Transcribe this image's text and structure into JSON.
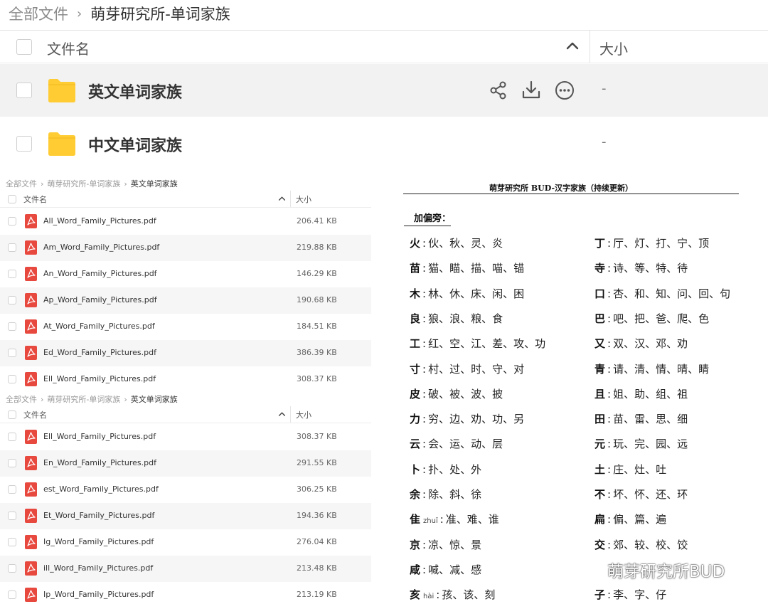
{
  "top_browser": {
    "breadcrumb_root": "全部文件",
    "breadcrumb_current": "萌芽研究所-单词家族",
    "header_name": "文件名",
    "header_size": "大小",
    "folders": [
      {
        "name": "英文单词家族",
        "size": "-"
      },
      {
        "name": "中文单词家族",
        "size": "-"
      }
    ]
  },
  "list_panel_1": {
    "breadcrumb": [
      "全部文件",
      "萌芽研究所-单词家族",
      "英文单词家族"
    ],
    "header_name": "文件名",
    "header_size": "大小",
    "files": [
      {
        "name": "All_Word_Family_Pictures.pdf",
        "size": "206.41 KB"
      },
      {
        "name": "Am_Word_Family_Pictures.pdf",
        "size": "219.88 KB"
      },
      {
        "name": "An_Word_Family_Pictures.pdf",
        "size": "146.29 KB"
      },
      {
        "name": "Ap_Word_Family_Pictures.pdf",
        "size": "190.68 KB"
      },
      {
        "name": "At_Word_Family_Pictures.pdf",
        "size": "184.51 KB"
      },
      {
        "name": "Ed_Word_Family_Pictures.pdf",
        "size": "386.39 KB"
      },
      {
        "name": "Ell_Word_Family_Pictures.pdf",
        "size": "308.37 KB"
      }
    ]
  },
  "list_panel_2": {
    "breadcrumb": [
      "全部文件",
      "萌芽研究所-单词家族",
      "英文单词家族"
    ],
    "header_name": "文件名",
    "header_size": "大小",
    "files": [
      {
        "name": "Ell_Word_Family_Pictures.pdf",
        "size": "308.37 KB"
      },
      {
        "name": "En_Word_Family_Pictures.pdf",
        "size": "291.55 KB"
      },
      {
        "name": "est_Word_Family_Pictures.pdf",
        "size": "306.25 KB"
      },
      {
        "name": "Et_Word_Family_Pictures.pdf",
        "size": "194.36 KB"
      },
      {
        "name": "Ig_Word_Family_Pictures.pdf",
        "size": "276.04 KB"
      },
      {
        "name": "ill_Word_Family_Pictures.pdf",
        "size": "213.48 KB"
      },
      {
        "name": "Ip_Word_Family_Pictures.pdf",
        "size": "213.19 KB"
      }
    ]
  },
  "document": {
    "title": "萌芽研究所 BUD-汉字家族（持续更新）",
    "section": "加偏旁：",
    "left_column": [
      {
        "radical": "火",
        "pinyin": "",
        "chars": "伙、秋、灵、炎"
      },
      {
        "radical": "苗",
        "pinyin": "",
        "chars": "猫、瞄、描、喵、锚"
      },
      {
        "radical": "木",
        "pinyin": "",
        "chars": "林、休、床、闲、困"
      },
      {
        "radical": "良",
        "pinyin": "",
        "chars": "狼、浪、粮、食"
      },
      {
        "radical": "工",
        "pinyin": "",
        "chars": "红、空、江、差、攻、功"
      },
      {
        "radical": "寸",
        "pinyin": "",
        "chars": "村、过、时、守、对"
      },
      {
        "radical": "皮",
        "pinyin": "",
        "chars": "破、被、波、披"
      },
      {
        "radical": "力",
        "pinyin": "",
        "chars": "穷、边、劝、功、另"
      },
      {
        "radical": "云",
        "pinyin": "",
        "chars": "会、运、动、层"
      },
      {
        "radical": "卜",
        "pinyin": "",
        "chars": "扑、处、外"
      },
      {
        "radical": "余",
        "pinyin": "",
        "chars": "除、斜、徐"
      },
      {
        "radical": "隹",
        "pinyin": "zhuī",
        "chars": "准、难、谁"
      },
      {
        "radical": "京",
        "pinyin": "",
        "chars": "凉、惊、景"
      },
      {
        "radical": "咸",
        "pinyin": "",
        "chars": "喊、减、感"
      },
      {
        "radical": "亥",
        "pinyin": "hài",
        "chars": "孩、该、刻"
      }
    ],
    "right_column": [
      {
        "radical": "丁",
        "pinyin": "",
        "chars": "厅、灯、打、宁、顶"
      },
      {
        "radical": "寺",
        "pinyin": "",
        "chars": "诗、等、特、待"
      },
      {
        "radical": "口",
        "pinyin": "",
        "chars": "杏、和、知、问、回、句"
      },
      {
        "radical": "巴",
        "pinyin": "",
        "chars": "吧、把、爸、爬、色"
      },
      {
        "radical": "又",
        "pinyin": "",
        "chars": "双、汉、邓、劝"
      },
      {
        "radical": "青",
        "pinyin": "",
        "chars": "请、清、情、晴、睛"
      },
      {
        "radical": "且",
        "pinyin": "",
        "chars": "姐、助、组、祖"
      },
      {
        "radical": "田",
        "pinyin": "",
        "chars": "苗、雷、思、细"
      },
      {
        "radical": "元",
        "pinyin": "",
        "chars": "玩、完、园、远"
      },
      {
        "radical": "土",
        "pinyin": "",
        "chars": "庄、灶、吐"
      },
      {
        "radical": "不",
        "pinyin": "",
        "chars": "坏、怀、还、环"
      },
      {
        "radical": "扁",
        "pinyin": "",
        "chars": "偏、篇、遍"
      },
      {
        "radical": "交",
        "pinyin": "",
        "chars": "郊、较、校、饺"
      },
      {
        "radical": "",
        "pinyin": "",
        "chars": ""
      },
      {
        "radical": "子",
        "pinyin": "",
        "chars": "李、字、仔"
      }
    ]
  },
  "watermark": {
    "text": "萌芽研究所BUD",
    "icon": "wechat-icon"
  },
  "colors": {
    "folder": "#ffcc33",
    "pdf": "#e8493f",
    "row_highlight": "#f2f2f2"
  }
}
